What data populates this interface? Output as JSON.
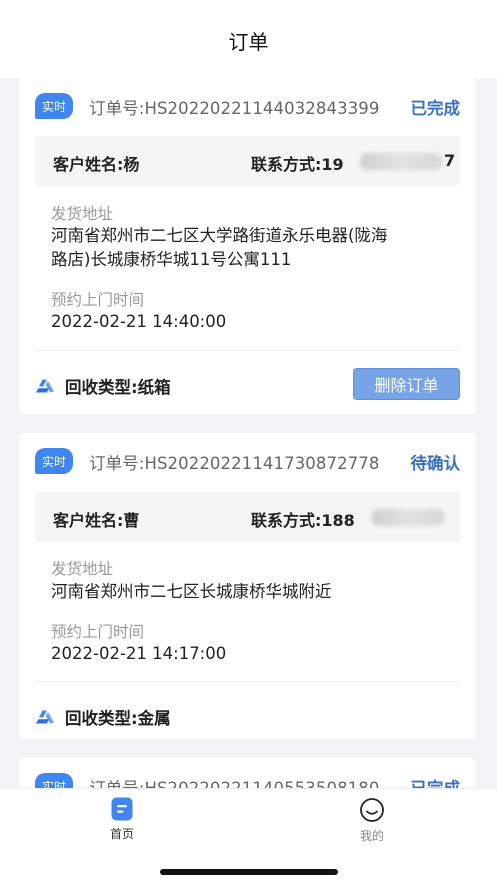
{
  "header": {
    "title": "订单"
  },
  "orders": [
    {
      "tag": "实时",
      "order_no": "订单号:HS20220221144032843399",
      "status": "已完成",
      "customer_name": "客户姓名:杨",
      "contact": "联系方式:19",
      "contact_tail": "7",
      "address_label": "发货地址",
      "address_line1": "河南省郑州市二七区大学路街道永乐电器(陇海",
      "address_line2": "路店)长城康桥华城11号公寓111",
      "time_label": "预约上门时间",
      "time": "2022-02-21 14:40:00",
      "type": "回收类型:纸箱",
      "delete_label": "删除订单"
    },
    {
      "tag": "实时",
      "order_no": "订单号:HS20220221141730872778",
      "status": "待确认",
      "customer_name": "客户姓名:曹",
      "contact": "联系方式:188",
      "address_label": "发货地址",
      "address_line1": "河南省郑州市二七区长城康桥华城附近",
      "time_label": "预约上门时间",
      "time": "2022-02-21 14:17:00",
      "type": "回收类型:金属"
    },
    {
      "tag": "实时",
      "order_no": "订单号:HS20220221140553508180",
      "status": "已完成"
    }
  ],
  "tabbar": {
    "home_label": "首页",
    "mine_label": "我的"
  },
  "colors": {
    "accent": "#3f86f0",
    "status_text": "#3a6fc1",
    "delete_button": "#76a4e6"
  },
  "icons": {
    "type": "recycle-triangle-icon",
    "home": "home-doc-icon",
    "mine": "smile-face-icon"
  }
}
